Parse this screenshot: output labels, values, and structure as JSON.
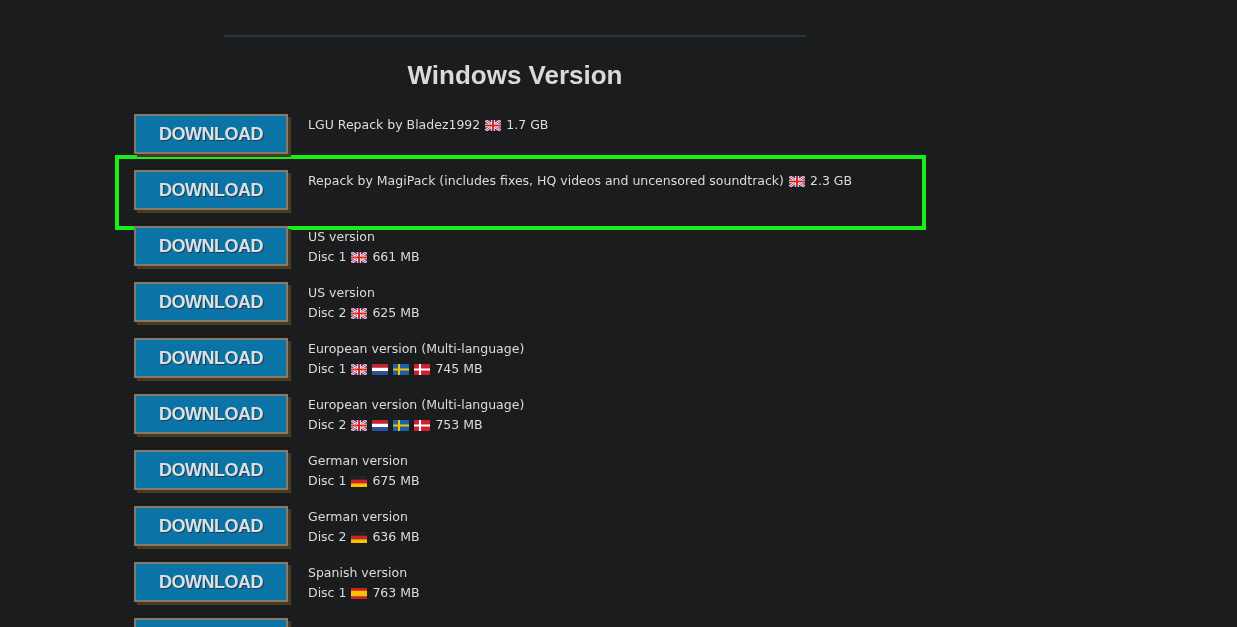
{
  "heading": "Windows Version",
  "downloads": [
    {
      "button": "DOWNLOAD",
      "title": "LGU Repack by Bladez1992",
      "flags": [
        {
          "kind": "uk"
        }
      ],
      "size": "1.7 GB",
      "highlighted": false
    },
    {
      "button": "DOWNLOAD",
      "title": "Repack by MagiPack (includes fixes, HQ videos and uncensored soundtrack)",
      "flags": [
        {
          "kind": "uk"
        }
      ],
      "size": "2.3 GB",
      "highlighted": true
    },
    {
      "button": "DOWNLOAD",
      "title": "US version",
      "disc": "Disc 1",
      "flags": [
        {
          "kind": "uk"
        }
      ],
      "size": "661 MB",
      "highlighted": false
    },
    {
      "button": "DOWNLOAD",
      "title": "US version",
      "disc": "Disc 2",
      "flags": [
        {
          "kind": "uk"
        }
      ],
      "size": "625 MB",
      "highlighted": false
    },
    {
      "button": "DOWNLOAD",
      "title": "European version (Multi-language)",
      "disc": "Disc 1",
      "flags": [
        {
          "kind": "uk"
        },
        {
          "kind": "nl"
        },
        {
          "kind": "se"
        },
        {
          "kind": "dk"
        }
      ],
      "size": "745 MB",
      "highlighted": false
    },
    {
      "button": "DOWNLOAD",
      "title": "European version (Multi-language)",
      "disc": "Disc 2",
      "flags": [
        {
          "kind": "uk"
        },
        {
          "kind": "nl"
        },
        {
          "kind": "se"
        },
        {
          "kind": "dk"
        }
      ],
      "size": "753 MB",
      "highlighted": false
    },
    {
      "button": "DOWNLOAD",
      "title": "German version",
      "disc": "Disc 1",
      "flags": [
        {
          "kind": "de"
        }
      ],
      "size": "675 MB",
      "highlighted": false
    },
    {
      "button": "DOWNLOAD",
      "title": "German version",
      "disc": "Disc 2",
      "flags": [
        {
          "kind": "de"
        }
      ],
      "size": "636 MB",
      "highlighted": false
    },
    {
      "button": "DOWNLOAD",
      "title": "Spanish version",
      "disc": "Disc 1",
      "flags": [
        {
          "kind": "es"
        }
      ],
      "size": "763 MB",
      "highlighted": false
    }
  ]
}
